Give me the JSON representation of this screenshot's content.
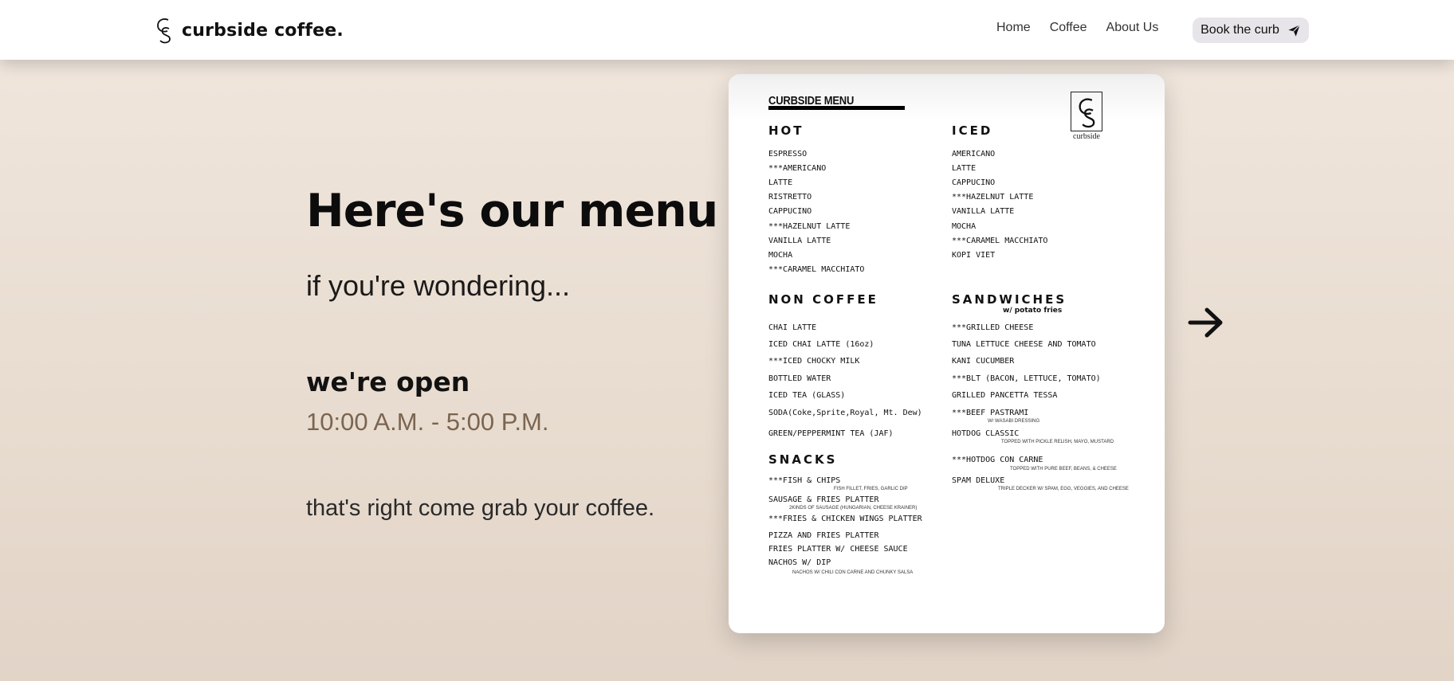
{
  "nav": {
    "brand": "curbside coffee.",
    "links": [
      "Home",
      "Coffee",
      "About Us"
    ],
    "cta": "Book the curb"
  },
  "hero": {
    "title": "Here's our menu",
    "subtitle": "if you're wondering...",
    "open_label": "we're open",
    "hours": "10:00 A.M. - 5:00 P.M.",
    "tagline": "that's right come grab your coffee."
  },
  "menu": {
    "header": "CURBSIDE MENU",
    "logo_text": "curbside",
    "hot": {
      "title": "HOT",
      "items": [
        "ESPRESSO",
        "***AMERICANO",
        "LATTE",
        "RISTRETTO",
        "CAPPUCINO",
        "***HAZELNUT LATTE",
        "VANILLA LATTE",
        "MOCHA",
        "***CARAMEL MACCHIATO"
      ]
    },
    "iced": {
      "title": "ICED",
      "items": [
        "AMERICANO",
        "LATTE",
        "CAPPUCINO",
        "***HAZELNUT LATTE",
        "VANILLA LATTE",
        "MOCHA",
        "***CARAMEL MACCHIATO",
        "KOPI VIET"
      ]
    },
    "non_coffee": {
      "title": "NON COFFEE",
      "items": [
        "CHAI LATTE",
        "ICED CHAI LATTE (16oz)",
        "***ICED CHOCKY MILK",
        "BOTTLED WATER",
        "ICED TEA (GLASS)",
        "SODA(Coke,Sprite,Royal, Mt. Dew)",
        "GREEN/PEPPERMINT TEA (JAF)"
      ]
    },
    "sandwiches": {
      "title": "SANDWICHES",
      "note": "w/ potato fries",
      "items": [
        "***GRILLED CHEESE",
        "TUNA LETTUCE CHEESE AND TOMATO",
        "KANI CUCUMBER",
        "***BLT (BACON, LETTUCE, TOMATO)",
        "GRILLED PANCETTA TESSA",
        "***BEEF PASTRAMI",
        "HOTDOG CLASSIC",
        "***HOTDOG CON CARNE",
        "SPAM DELUXE"
      ],
      "subs": [
        "W/ WASABI DRESSING",
        "TOPPED WITH PICKLE RELISH, MAYO, MUSTARD",
        "TOPPED WITH PURE BEEF, BEANS, & CHEESE",
        "TRIPLE DECKER W/ SPAM, EGG, VEGGIES, AND CHEESE"
      ]
    },
    "snacks": {
      "title": "SNACKS",
      "items": [
        "***FISH & CHIPS",
        "SAUSAGE & FRIES PLATTER",
        "***FRIES & CHICKEN WINGS PLATTER",
        "PIZZA AND FRIES PLATTER",
        "FRIES PLATTER W/ CHEESE SAUCE",
        "NACHOS W/ DIP"
      ],
      "subs": [
        "FISH FILLET, FRIES, GARLIC DIP",
        "2KINDS OF SAUSAGE (HUNGARIAN, CHEESE KRAINER)",
        "NACHOS W/ CHILI CON CARNE AND CHUNKY SALSA"
      ]
    }
  },
  "icons": {
    "brand_logo": "cs-monogram-icon",
    "cta_icon": "paper-plane-icon",
    "next": "arrow-right-icon"
  }
}
